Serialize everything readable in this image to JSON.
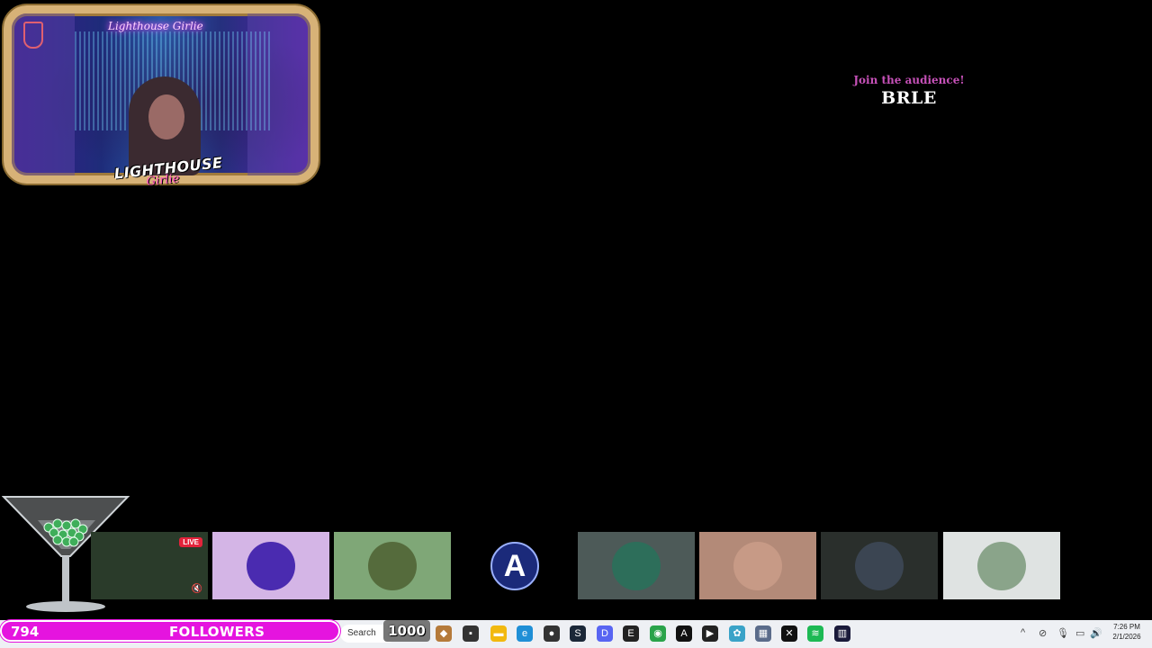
{
  "camera": {
    "neon_sign": "Lighthouse Girlie",
    "logo_line1": "LIGHTHOUSE",
    "logo_line2": "Girlie"
  },
  "audience_widget": {
    "prompt": "Join the audience!",
    "code": "BRLE"
  },
  "thumbnails": [
    {
      "name": "stream-preview",
      "bg": "#2a3b2a",
      "live_badge": "LIVE"
    },
    {
      "name": "lighthouse-logo",
      "bg": "#d4b5e6",
      "circle": "#4a2bb0"
    },
    {
      "name": "green-logo",
      "bg": "#7fa777",
      "circle": "#556b3c"
    },
    {
      "name": "a-logo",
      "bg": "#000000",
      "circle": "#1b2a7a"
    },
    {
      "name": "aurora-logo",
      "bg": "#4d5a58",
      "circle": "#2d6e5a"
    },
    {
      "name": "profile-photo",
      "bg": "#b38a78",
      "circle": "#c79a86"
    },
    {
      "name": "wolf-avatar",
      "bg": "#2a2f2c",
      "circle": "#3b4552"
    },
    {
      "name": "airplane-photo",
      "bg": "#dfe3e2",
      "circle": "#8aa48a"
    }
  ],
  "followers": {
    "count": "794",
    "label": "FOLLOWERS",
    "goal": "1000"
  },
  "taskbar": {
    "search_label": "Search",
    "icons": [
      {
        "name": "widgets-icon",
        "color": "#b57a3a",
        "glyph": "◆"
      },
      {
        "name": "task-view-icon",
        "color": "#333333",
        "glyph": "▪"
      },
      {
        "name": "file-explorer-icon",
        "color": "#f2b90f",
        "glyph": "▬"
      },
      {
        "name": "edge-icon",
        "color": "#1f8fd6",
        "glyph": "e"
      },
      {
        "name": "obs-icon",
        "color": "#333333",
        "glyph": "●"
      },
      {
        "name": "steam-icon",
        "color": "#1b2838",
        "glyph": "S"
      },
      {
        "name": "discord-icon",
        "color": "#5865f2",
        "glyph": "D"
      },
      {
        "name": "epic-games-icon",
        "color": "#222222",
        "glyph": "E"
      },
      {
        "name": "chrome-icon",
        "color": "#2aa34a",
        "glyph": "◉"
      },
      {
        "name": "adobe-icon",
        "color": "#111111",
        "glyph": "A"
      },
      {
        "name": "media-player-icon",
        "color": "#222222",
        "glyph": "▶"
      },
      {
        "name": "photos-icon",
        "color": "#3aa3c8",
        "glyph": "✿"
      },
      {
        "name": "calculator-icon",
        "color": "#5a6b8a",
        "glyph": "▦"
      },
      {
        "name": "capcut-icon",
        "color": "#111111",
        "glyph": "✕"
      },
      {
        "name": "spotify-icon",
        "color": "#1db954",
        "glyph": "≋"
      },
      {
        "name": "streamdeck-icon",
        "color": "#1a1a3a",
        "glyph": "▥"
      }
    ],
    "tray": {
      "chevron": "^",
      "network_glyph": "⊘",
      "mic_glyph": "🎙",
      "display_glyph": "▭",
      "volume_glyph": "🔊"
    },
    "time": "7:26 PM",
    "date": "2/1/2026"
  }
}
